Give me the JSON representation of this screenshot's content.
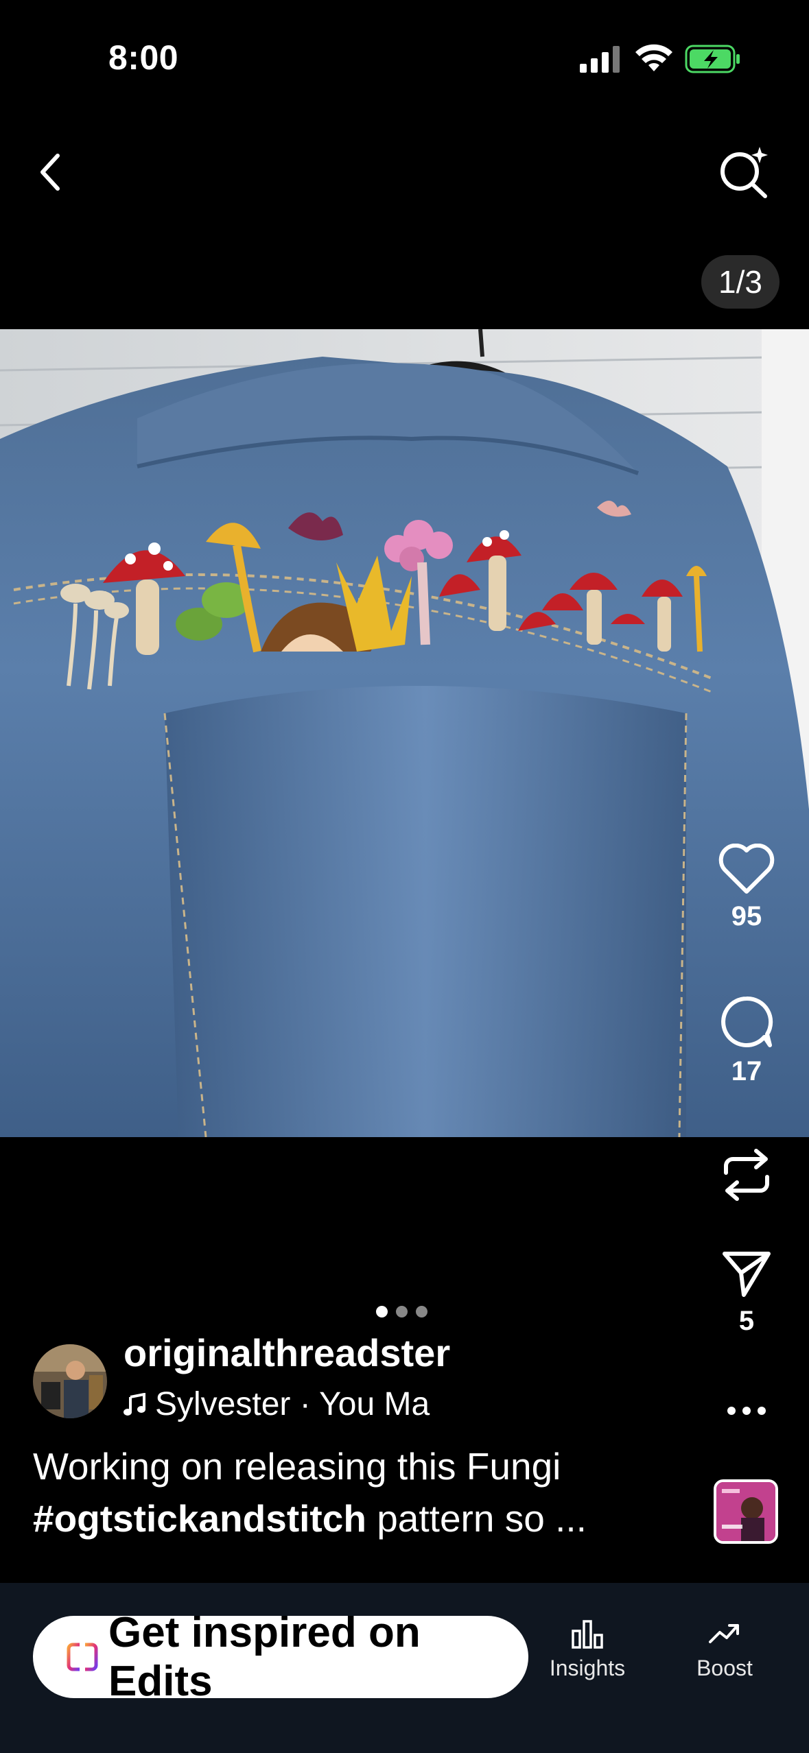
{
  "status": {
    "time": "8:00",
    "battery_color": "#4cd964"
  },
  "nav": {
    "back_icon": "chevron-left-icon",
    "search_icon": "ai-search-icon",
    "counter": "1/3"
  },
  "post": {
    "carousel_index": 1,
    "carousel_total": 3,
    "likes": "95",
    "comments": "17",
    "shares": "5",
    "author": "originalthreadster",
    "music": "Sylvester · You Ma",
    "caption_line1": "Working on releasing this Fungi",
    "caption_tag": "#ogtstickandstitch",
    "caption_rest": " pattern so ..."
  },
  "bottom": {
    "edits_label": "Get inspired on Edits",
    "insights_label": "Insights",
    "boost_label": "Boost"
  }
}
